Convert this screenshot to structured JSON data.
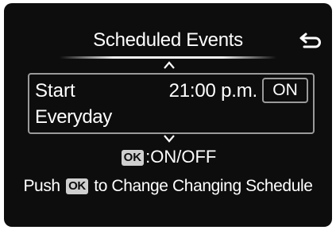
{
  "screen": {
    "title": "Scheduled Events"
  },
  "schedule_item": {
    "label": "Start",
    "time": "21:00 p.m.",
    "state": "ON",
    "repeat": "Everyday"
  },
  "hints": {
    "ok_key": "OK",
    "toggle_text": ":ON/OFF",
    "push_prefix": "Push",
    "push_suffix": "to Change Changing Schedule"
  },
  "icons": {
    "back": "back-arrow-icon",
    "up": "chevron-up-icon",
    "down": "chevron-down-icon"
  }
}
